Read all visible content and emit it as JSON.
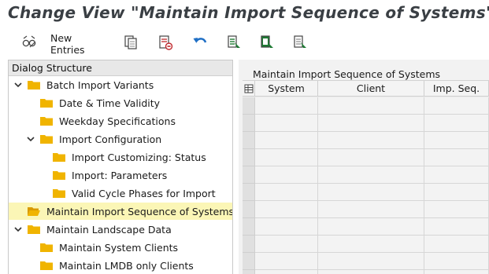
{
  "window": {
    "title": "Change View \"Maintain Import Sequence of Systems\": Overv"
  },
  "toolbar": {
    "buttons": [
      {
        "icon": "glasses-toggle-icon"
      },
      {
        "label": "New Entries"
      },
      {
        "icon": "copy-icon"
      },
      {
        "icon": "delete-icon"
      },
      {
        "icon": "undo-icon"
      },
      {
        "icon": "select-all-icon"
      },
      {
        "icon": "select-block-icon"
      },
      {
        "icon": "deselect-all-icon"
      }
    ]
  },
  "dialog_structure": {
    "header": "Dialog Structure",
    "nodes": [
      {
        "label": "Batch Import Variants",
        "level": 0,
        "expanded": true
      },
      {
        "label": "Date & Time Validity",
        "level": 1
      },
      {
        "label": "Weekday Specifications",
        "level": 1
      },
      {
        "label": "Import Configuration",
        "level": 1,
        "expanded": true
      },
      {
        "label": "Import Customizing: Status",
        "level": 2
      },
      {
        "label": "Import: Parameters",
        "level": 2
      },
      {
        "label": "Valid Cycle Phases for Import",
        "level": 2
      },
      {
        "label": "Maintain Import Sequence of Systems",
        "level": 0,
        "selected": true
      },
      {
        "label": "Maintain Landscape Data",
        "level": 0,
        "expanded": true
      },
      {
        "label": "Maintain System Clients",
        "level": 1
      },
      {
        "label": "Maintain LMDB only Clients",
        "level": 1
      }
    ]
  },
  "table": {
    "title": "Maintain Import Sequence of Systems",
    "columns": [
      "System",
      "Client",
      "Imp. Seq."
    ],
    "rows": 11
  },
  "colors": {
    "folder": "#f0b400",
    "selected_node": "#fbf6b6",
    "accent_green": "#1e7b34",
    "accent_red": "#c0282d",
    "accent_blue": "#1f6fc5"
  }
}
